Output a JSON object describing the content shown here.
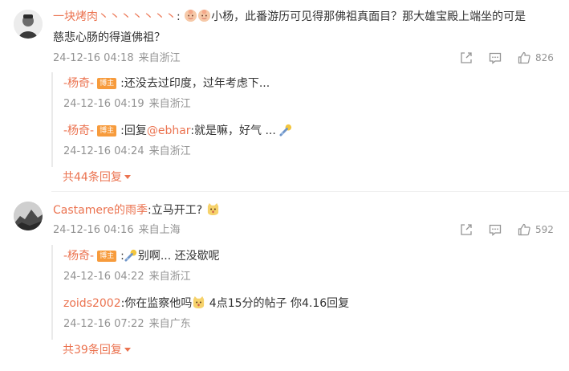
{
  "comments": [
    {
      "user": "一块烤肉丶丶丶丶丶丶丶",
      "text_lead": ":",
      "emojis": [
        "baby-emoji",
        "baby-emoji"
      ],
      "text": "小杨，此番游历可见得那佛祖真面目？那大雄宝殿上端坐的可是",
      "text_line2": "慈悲心肠的得道佛祖？",
      "time": "24-12-16 04:18",
      "location": "来自浙江",
      "like_count": "826",
      "replies": [
        {
          "user": "-杨奇-",
          "badge": "博主",
          "text": ":还没去过印度，过年考虑下...",
          "time": "24-12-16 04:19",
          "location": "来自浙江"
        },
        {
          "user": "-杨奇-",
          "badge": "博主",
          "text_prefix": ":回复",
          "mention": "@ebhar",
          "text": ":就是嘛，好气 ...",
          "emoji": "sigh-emoji",
          "time": "24-12-16 04:24",
          "location": "来自浙江"
        }
      ],
      "more_replies": "共44条回复"
    },
    {
      "user": "Castamere的雨季",
      "text": ":立马开工?",
      "emoji": "cat-emoji",
      "time": "24-12-16 04:16",
      "location": "来自上海",
      "like_count": "592",
      "replies": [
        {
          "user": "-杨奇-",
          "badge": "博主",
          "text_prefix": ":",
          "emoji": "sigh-emoji",
          "text": "别啊... 还没歇呢",
          "time": "24-12-16 04:22",
          "location": "来自浙江"
        },
        {
          "user": "zoids2002",
          "text": ":你在监察他吗",
          "emoji": "cat-emoji",
          "text_after": "4点15分的帖子 你4.16回复",
          "time": "24-12-16 07:22",
          "location": "来自广东"
        }
      ],
      "more_replies": "共39条回复"
    }
  ],
  "colors": {
    "accent": "#eb7350",
    "meta": "#939393",
    "badge": "#f79b3c"
  },
  "icons": [
    "share-icon",
    "comment-icon",
    "like-icon"
  ]
}
